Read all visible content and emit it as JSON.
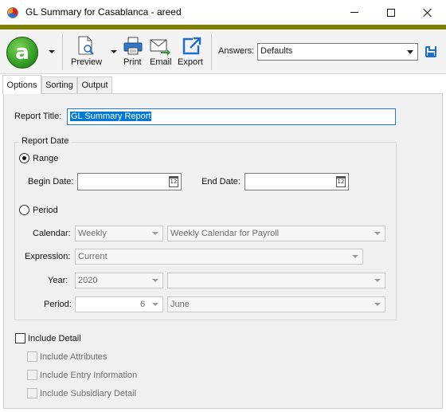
{
  "window": {
    "title": "GL Summary for Casablanca - areed"
  },
  "toolbar": {
    "preview_label": "Preview",
    "print_label": "Print",
    "email_label": "Email",
    "export_label": "Export",
    "answers_label": "Answers:",
    "answers_value": "Defaults",
    "icons": [
      "app-logo-icon",
      "preview-icon",
      "print-icon",
      "email-icon",
      "export-icon",
      "save-icon"
    ],
    "accent_color": "#808000"
  },
  "tabs": [
    {
      "label": "Options",
      "active": true
    },
    {
      "label": "Sorting",
      "active": false
    },
    {
      "label": "Output",
      "active": false
    }
  ],
  "form": {
    "report_title_label": "Report Title:",
    "report_title_value": "GL Summary Report",
    "report_date_group": "Report Date",
    "range_label": "Range",
    "begin_date_label": "Begin Date:",
    "begin_date_value": "",
    "end_date_label": "End Date:",
    "end_date_value": "",
    "period_label": "Period",
    "calendar_label": "Calendar:",
    "calendar_type": "Weekly",
    "calendar_name": "Weekly Calendar for Payroll",
    "expression_label": "Expression:",
    "expression_value": "Current",
    "year_label": "Year:",
    "year_value": "2020",
    "year_extra": "",
    "period_field_label": "Period:",
    "period_number": "6",
    "period_month": "June",
    "include_detail_label": "Include Detail",
    "include_attributes_label": "Include Attributes",
    "include_entry_label": "Include Entry Information",
    "include_subsidiary_label": "Include Subsidiary Detail",
    "calendar_icon_text": "12"
  }
}
